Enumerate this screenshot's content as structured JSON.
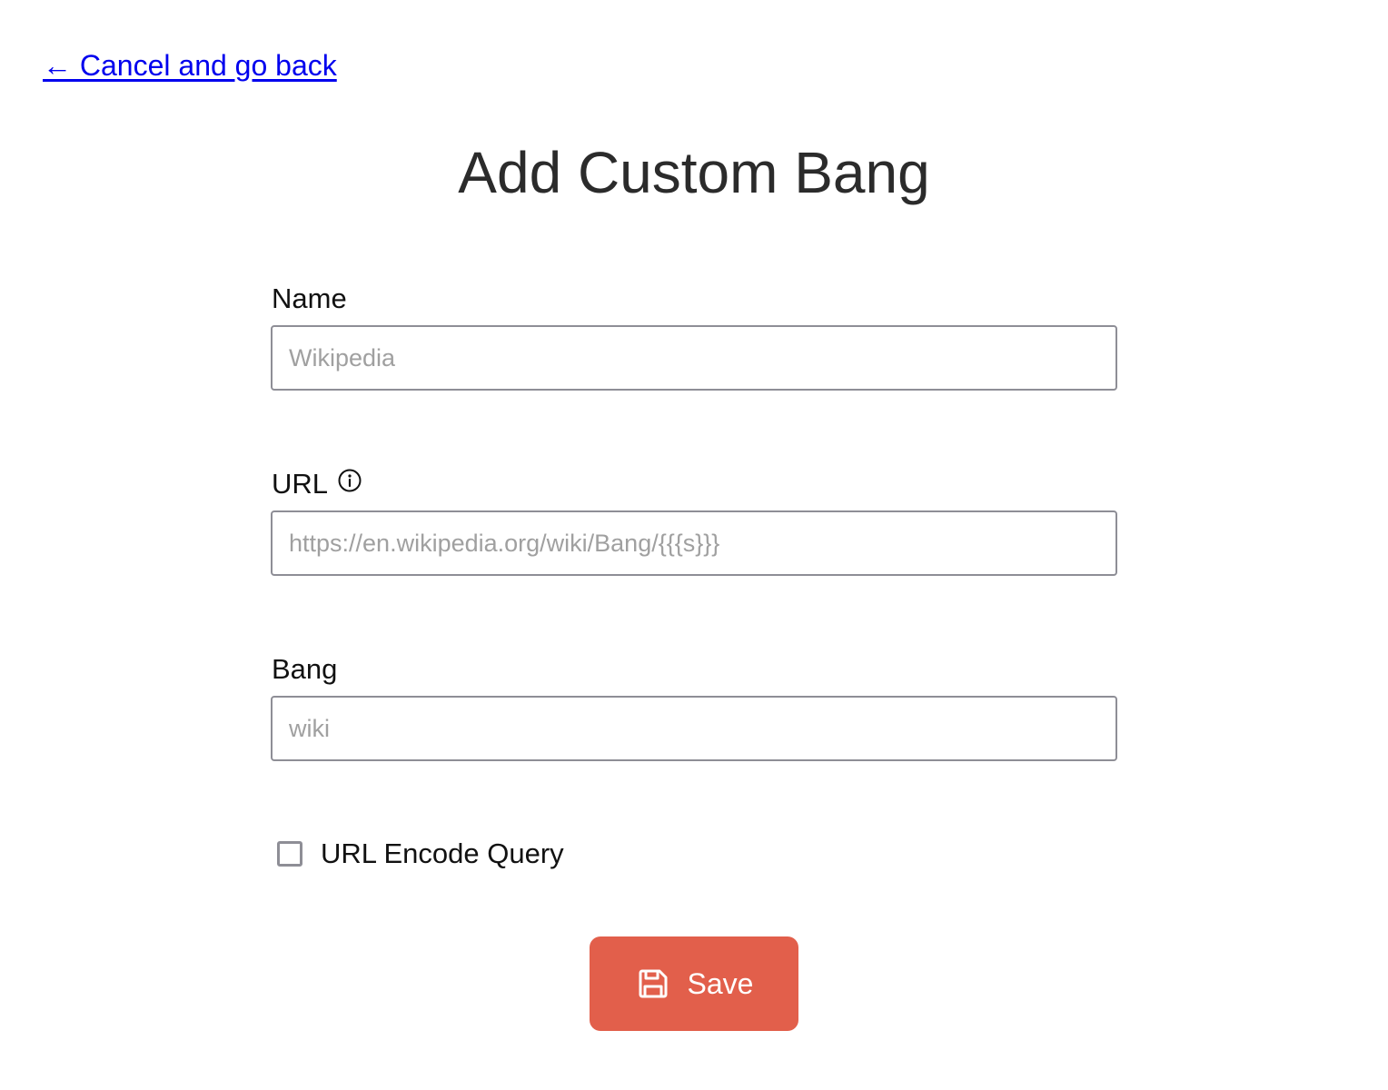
{
  "nav": {
    "back_label": "← Cancel and go back"
  },
  "page": {
    "title": "Add Custom Bang"
  },
  "form": {
    "name": {
      "label": "Name",
      "placeholder": "Wikipedia",
      "value": ""
    },
    "url": {
      "label": "URL",
      "placeholder": "https://en.wikipedia.org/wiki/Bang/{{{s}}}",
      "value": "",
      "icon": "info-icon"
    },
    "bang": {
      "label": "Bang",
      "placeholder": "wiki",
      "value": ""
    },
    "encode_query": {
      "label": "URL Encode Query",
      "checked": false
    },
    "save": {
      "label": "Save",
      "icon": "save-icon"
    }
  },
  "colors": {
    "link": "#0000ee",
    "primary_button": "#e25f4b",
    "input_border": "#8e8e96",
    "placeholder": "#a0a0a0"
  }
}
